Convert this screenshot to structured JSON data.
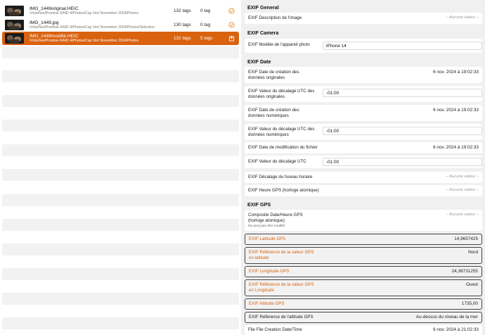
{
  "files": [
    {
      "name": "IMG_1449original.HEIC",
      "path": "/Volumes/Promise RAID 4/Photos/Cap Vert Novembre 2024/Photos",
      "tags": "132 tags",
      "tags2": "0 tag",
      "status_icon": "check-circle-icon"
    },
    {
      "name": "IMG_1449.jpg",
      "path": "/Volumes/Promise RAID 4/Photos/Cap Vert Novembre 2024/Photos/Sélection",
      "tags": "130 tags",
      "tags2": "0 tag",
      "status_icon": "check-circle-icon"
    },
    {
      "name": "IMG_1449modifié.HEIC",
      "path": "/Volumes/Promise RAID 4/Photos/Cap Vert Novembre 2024/Photos",
      "tags": "132 tags",
      "tags2": "5 tags",
      "status_icon": "save-icon"
    }
  ],
  "selected_index": 2,
  "colors": {
    "accent": "#d9620f",
    "check": "#e88a1a"
  },
  "sections": {
    "general": "EXIF General",
    "camera": "EXIF Camera",
    "date": "EXIF Date",
    "gps": "EXIF GPS"
  },
  "none_value": "– Aucune valeur –",
  "fields": {
    "description": {
      "label": "EXIF Description de l'image"
    },
    "model": {
      "label": "EXIF Modèle de l'appareil photo",
      "value": "iPhone 14"
    },
    "date_orig": {
      "label": "EXIF Date de création des données originales",
      "value": "6 nov. 2024 à 19:02:33"
    },
    "offset_orig": {
      "label": "EXIF Valeur du décalage UTC des données originales",
      "value": "-01:00"
    },
    "date_digit": {
      "label": "EXIF Date de création des données numériques",
      "value": "6 nov. 2024 à 19:02:33"
    },
    "offset_digit": {
      "label": "EXIF Valeur du décalage UTC des données numériques",
      "value": "-01:00"
    },
    "date_mod": {
      "label": "EXIF Date de modification du fichier",
      "value": "6 nov. 2024 à 19:02:33"
    },
    "offset_utc": {
      "label": "EXIF Valeur du décalage UTC",
      "value": "-01:00"
    },
    "tz": {
      "label": "EXIF Décalage du fuseau horaire"
    },
    "gps_time": {
      "label": "EXIF Heure GPS (horloge atomique)"
    },
    "composite": {
      "label": "Composite Date/Heure GPS (horloge atomique)",
      "note": "Ne peut pas être modifié"
    },
    "lat": {
      "label": "EXIF Latitude GPS",
      "value": "14,9657425"
    },
    "lat_ref": {
      "label": "EXIF Référence de la valeur GPS en latitude",
      "value": "Nord"
    },
    "lon": {
      "label": "EXIF Longitude GPS",
      "value": "24,36731255"
    },
    "lon_ref": {
      "label": "EXIF Référence de la valeur GPS en Longitude",
      "value": "Ouest"
    },
    "alt": {
      "label": "EXIF Altitude GPS",
      "value": "1735,00"
    },
    "alt_ref": {
      "label": "EXIF Référence de l'altitude GPS",
      "value": "Au-dessus du niveau de la mer"
    },
    "file_date": {
      "label": "File File Creation Date/Time",
      "value": "6 nov. 2024 à 21:02:33"
    }
  }
}
